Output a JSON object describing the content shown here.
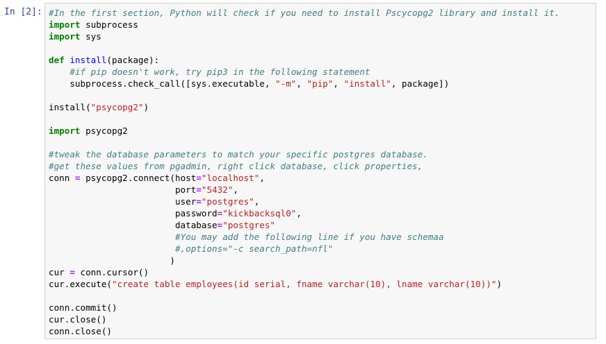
{
  "cell": {
    "prompt": "In [2]:",
    "lines": [
      [
        {
          "t": "#In the first section, Python will check if you need to install Pscycopg2 library and install it.",
          "k": "cmt"
        }
      ],
      [
        {
          "t": "import",
          "k": "kw"
        },
        {
          "t": " subprocess",
          "k": "txt"
        }
      ],
      [
        {
          "t": "import",
          "k": "kw"
        },
        {
          "t": " sys",
          "k": "txt"
        }
      ],
      [],
      [
        {
          "t": "def",
          "k": "kw"
        },
        {
          "t": " ",
          "k": "txt"
        },
        {
          "t": "install",
          "k": "fn"
        },
        {
          "t": "(package):",
          "k": "txt"
        }
      ],
      [
        {
          "t": "    ",
          "k": "txt"
        },
        {
          "t": "#if pip doesn't work, try pip3 in the following statement",
          "k": "cmt"
        }
      ],
      [
        {
          "t": "    subprocess.check_call([sys.executable, ",
          "k": "txt"
        },
        {
          "t": "\"-m\"",
          "k": "str"
        },
        {
          "t": ", ",
          "k": "txt"
        },
        {
          "t": "\"pip\"",
          "k": "str"
        },
        {
          "t": ", ",
          "k": "txt"
        },
        {
          "t": "\"install\"",
          "k": "str"
        },
        {
          "t": ", package])",
          "k": "txt"
        }
      ],
      [],
      [
        {
          "t": "install(",
          "k": "txt"
        },
        {
          "t": "\"psycopg2\"",
          "k": "str"
        },
        {
          "t": ")",
          "k": "txt"
        }
      ],
      [],
      [
        {
          "t": "import",
          "k": "kw"
        },
        {
          "t": " psycopg2",
          "k": "txt"
        }
      ],
      [],
      [
        {
          "t": "#tweak the database parameters to match your specific postgres database.",
          "k": "cmt"
        }
      ],
      [
        {
          "t": "#get these values from pgadmin, right click database, click properties,",
          "k": "cmt"
        }
      ],
      [
        {
          "t": "conn ",
          "k": "txt"
        },
        {
          "t": "=",
          "k": "op"
        },
        {
          "t": " psycopg2.connect(host",
          "k": "txt"
        },
        {
          "t": "=",
          "k": "op"
        },
        {
          "t": "\"localhost\"",
          "k": "str"
        },
        {
          "t": ",",
          "k": "txt"
        }
      ],
      [
        {
          "t": "                        port",
          "k": "txt"
        },
        {
          "t": "=",
          "k": "op"
        },
        {
          "t": "\"5432\"",
          "k": "str"
        },
        {
          "t": ",",
          "k": "txt"
        }
      ],
      [
        {
          "t": "                        user",
          "k": "txt"
        },
        {
          "t": "=",
          "k": "op"
        },
        {
          "t": "\"postgres\"",
          "k": "str"
        },
        {
          "t": ",",
          "k": "txt"
        }
      ],
      [
        {
          "t": "                        password",
          "k": "txt"
        },
        {
          "t": "=",
          "k": "op"
        },
        {
          "t": "\"kickbacksql0\"",
          "k": "str"
        },
        {
          "t": ",",
          "k": "txt"
        }
      ],
      [
        {
          "t": "                        database",
          "k": "txt"
        },
        {
          "t": "=",
          "k": "op"
        },
        {
          "t": "\"postgres\"",
          "k": "str"
        }
      ],
      [
        {
          "t": "                        ",
          "k": "txt"
        },
        {
          "t": "#You may add the following line if you have schemaa",
          "k": "cmt"
        }
      ],
      [
        {
          "t": "                        ",
          "k": "txt"
        },
        {
          "t": "#,options=\"-c search_path=nfl\"",
          "k": "cmt"
        }
      ],
      [
        {
          "t": "                       )",
          "k": "txt"
        }
      ],
      [
        {
          "t": "cur ",
          "k": "txt"
        },
        {
          "t": "=",
          "k": "op"
        },
        {
          "t": " conn.cursor()",
          "k": "txt"
        }
      ],
      [
        {
          "t": "cur.execute(",
          "k": "txt"
        },
        {
          "t": "\"create table employees(id serial, fname varchar(10), lname varchar(10))\"",
          "k": "str"
        },
        {
          "t": ")",
          "k": "txt"
        }
      ],
      [],
      [
        {
          "t": "conn.commit()",
          "k": "txt"
        }
      ],
      [
        {
          "t": "cur.close()",
          "k": "txt"
        }
      ],
      [
        {
          "t": "conn.close()",
          "k": "txt"
        }
      ]
    ]
  }
}
